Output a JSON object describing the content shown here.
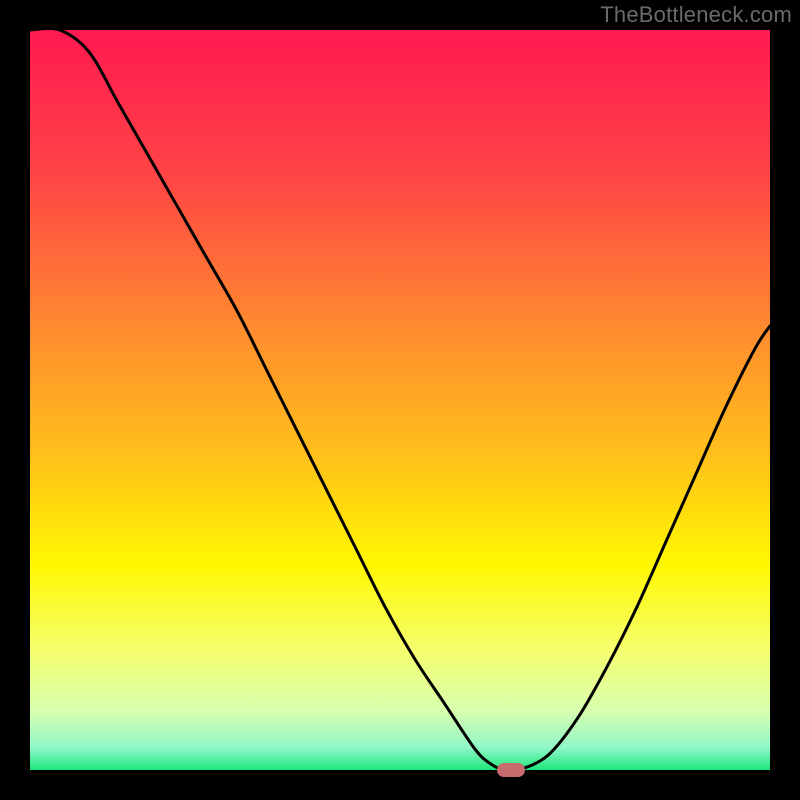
{
  "watermark": "TheBottleneck.com",
  "chart_data": {
    "type": "line",
    "title": "",
    "xlabel": "",
    "ylabel": "",
    "xlim": [
      0,
      100
    ],
    "ylim": [
      0,
      100
    ],
    "x": [
      0,
      4,
      8,
      12,
      16,
      20,
      24,
      28,
      32,
      36,
      40,
      44,
      48,
      52,
      56,
      60,
      62,
      64,
      66,
      70,
      74,
      78,
      82,
      86,
      90,
      94,
      98,
      100
    ],
    "values": [
      100,
      100,
      97,
      90,
      83,
      76,
      69,
      62,
      54,
      46,
      38,
      30,
      22,
      15,
      9,
      3,
      1,
      0,
      0,
      2,
      7,
      14,
      22,
      31,
      40,
      49,
      57,
      60
    ],
    "marker": {
      "x": 65,
      "y": 0
    },
    "background_gradient": {
      "stops": [
        {
          "pos": 0.0,
          "color": "#ff1950"
        },
        {
          "pos": 0.2,
          "color": "#ff4545"
        },
        {
          "pos": 0.4,
          "color": "#ff8a2f"
        },
        {
          "pos": 0.58,
          "color": "#ffc21a"
        },
        {
          "pos": 0.72,
          "color": "#fff700"
        },
        {
          "pos": 0.84,
          "color": "#f5ff70"
        },
        {
          "pos": 0.92,
          "color": "#d8ffb0"
        },
        {
          "pos": 0.97,
          "color": "#90f7c8"
        },
        {
          "pos": 1.0,
          "color": "#1de77b"
        }
      ]
    }
  }
}
